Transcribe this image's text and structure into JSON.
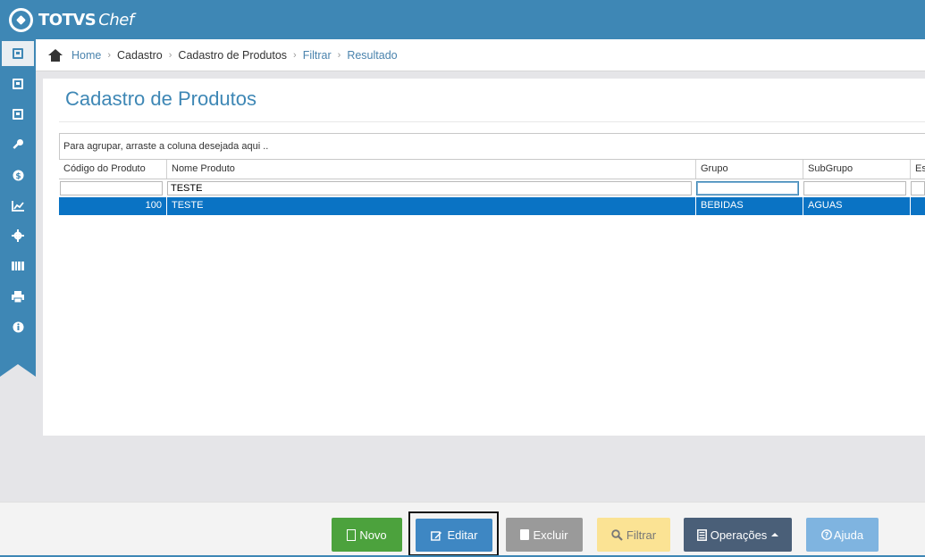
{
  "app": {
    "brand": "TOTVS",
    "brand_suffix": "Chef"
  },
  "sidebar": {
    "items": [
      {
        "icon": "book-icon"
      },
      {
        "icon": "book-icon"
      },
      {
        "icon": "book-icon"
      },
      {
        "icon": "key-icon"
      },
      {
        "icon": "dollar-icon"
      },
      {
        "icon": "chart-icon"
      },
      {
        "icon": "gear-icon"
      },
      {
        "icon": "barcode-icon"
      },
      {
        "icon": "printer-icon"
      },
      {
        "icon": "info-icon"
      }
    ]
  },
  "breadcrumb": {
    "items": [
      "Home",
      "Cadastro",
      "Cadastro de Produtos",
      "Filtrar",
      "Resultado"
    ]
  },
  "page": {
    "title": "Cadastro de Produtos"
  },
  "grid": {
    "group_hint": "Para agrupar, arraste a coluna desejada aqui ..",
    "columns": [
      "Código do Produto",
      "Nome Produto",
      "Grupo",
      "SubGrupo",
      "Est"
    ],
    "filters": [
      "",
      "TESTE",
      "",
      "",
      ""
    ],
    "rows": [
      {
        "codigo": "100",
        "nome": "TESTE",
        "grupo": "BEBIDAS",
        "subgrupo": "AGUAS",
        "est": ""
      }
    ]
  },
  "toolbar": {
    "novo": "Novo",
    "editar": "Editar",
    "excluir": "Excluir",
    "filtrar": "Filtrar",
    "operacoes": "Operações",
    "ajuda": "Ajuda"
  },
  "colors": {
    "primary": "#3e87b5",
    "selected_row": "#0a73c4",
    "novo": "#4ca23d",
    "editar": "#3e87c3",
    "excluir": "#9a9a9a",
    "filtrar": "#fbe394",
    "operacoes": "#4a5f78",
    "ajuda": "#7fb4e0"
  }
}
